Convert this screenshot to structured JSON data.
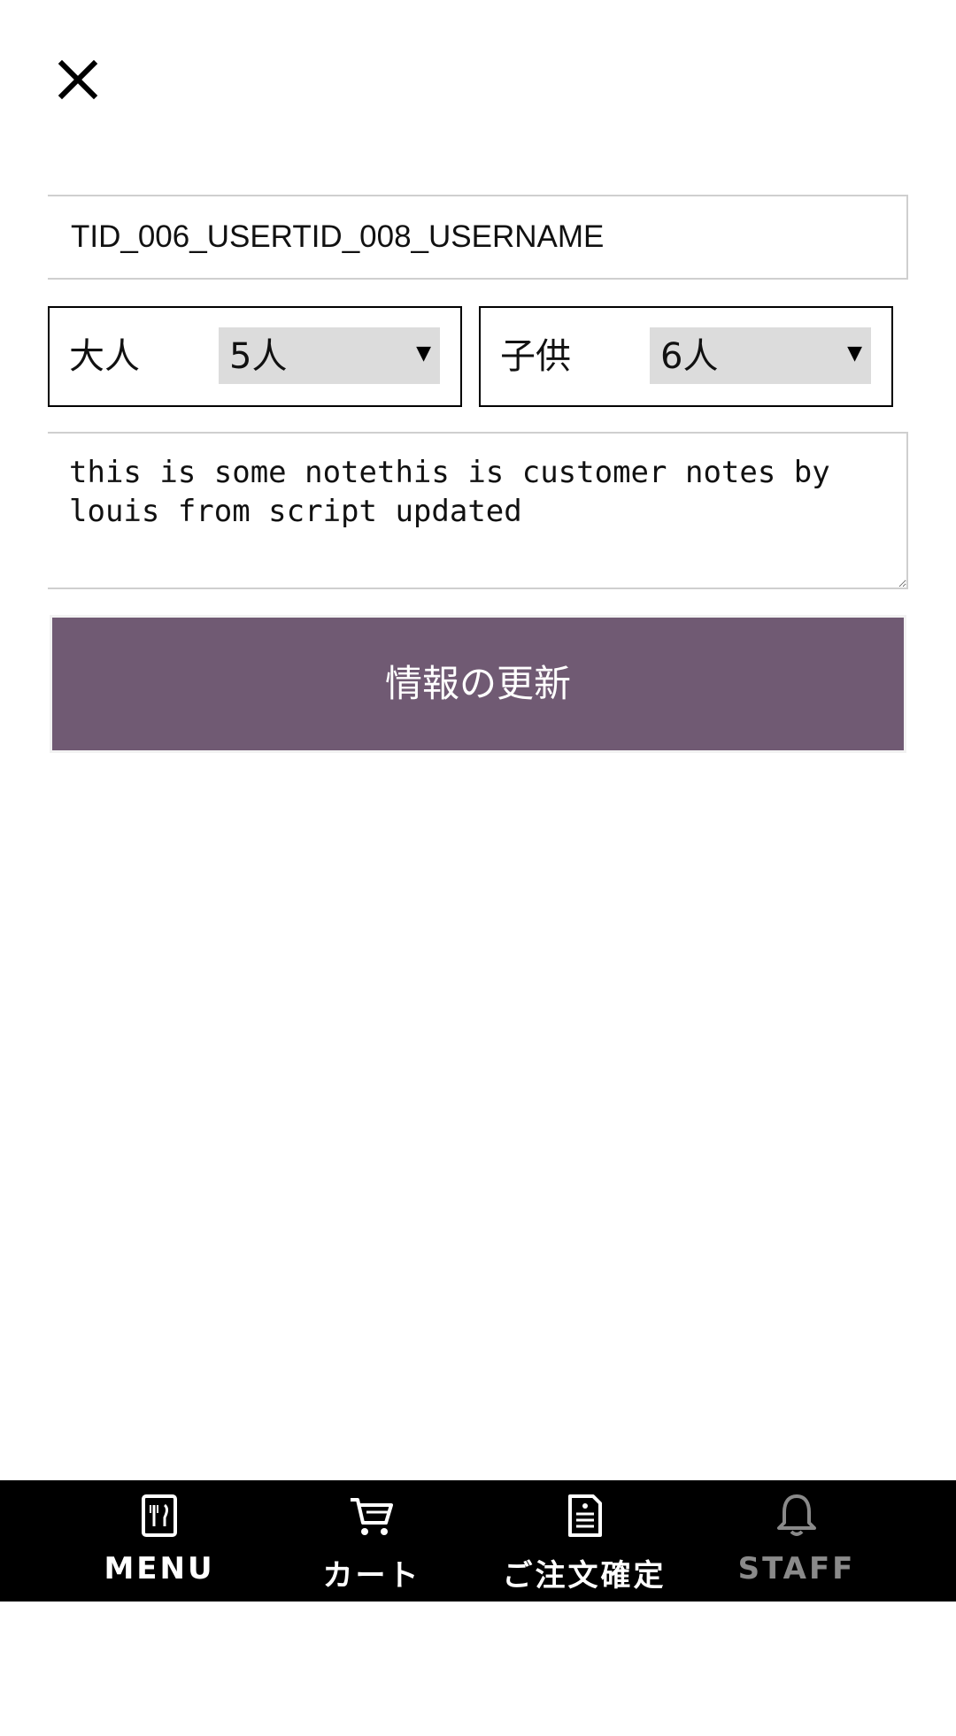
{
  "header": {
    "close_icon": "close-icon"
  },
  "form": {
    "name_value": "TID_006_USERTID_008_USERNAME",
    "adult": {
      "label": "大人",
      "value": "5人"
    },
    "child": {
      "label": "子供",
      "value": "6人"
    },
    "notes_value": "this is some notethis is customer notes by louis from script updated",
    "submit_label": "情報の更新"
  },
  "nav": {
    "items": [
      {
        "label": "MENU",
        "icon": "menu-icon"
      },
      {
        "label": "カート",
        "icon": "cart-icon"
      },
      {
        "label": "ご注文確定",
        "icon": "order-confirm-icon"
      },
      {
        "label": "STAFF",
        "icon": "bell-icon",
        "disabled": true
      }
    ]
  },
  "colors": {
    "accent": "#705a73",
    "nav_background": "#000000",
    "disabled_text": "#8a8a8a"
  }
}
